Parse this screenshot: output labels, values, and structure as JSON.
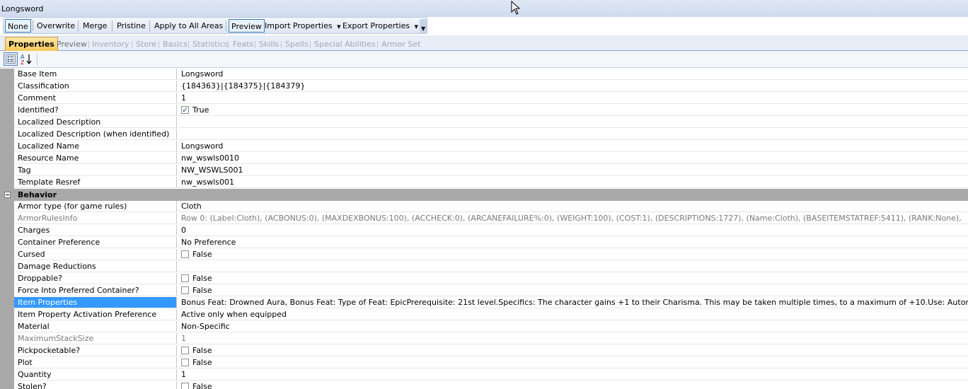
{
  "window": {
    "title": "Longsword"
  },
  "toolbar": {
    "none": "None",
    "overwrite": "Overwrite",
    "merge": "Merge",
    "pristine": "Pristine",
    "apply_all": "Apply to All Areas",
    "preview": "Preview",
    "import": "Import Properties",
    "export": "Export Properties"
  },
  "tabs": [
    "Properties",
    "Preview",
    "Inventory",
    "Store",
    "Basics",
    "Statistics",
    "Feats",
    "Skills",
    "Spells",
    "Special Abilities",
    "Armor Set"
  ],
  "properties": {
    "misc": [
      {
        "name": "Base Item",
        "value": "Longsword"
      },
      {
        "name": "Classification",
        "value": "{184363}|{184375}|{184379}"
      },
      {
        "name": "Comment",
        "value": "1"
      },
      {
        "name": "Identified?",
        "value": "True",
        "checkbox": true,
        "checked": true
      },
      {
        "name": "Localized Description",
        "value": ""
      },
      {
        "name": "Localized Description (when identified)",
        "value": ""
      },
      {
        "name": "Localized Name",
        "value": "Longsword"
      },
      {
        "name": "Resource Name",
        "value": "nw_wswls0010"
      },
      {
        "name": "Tag",
        "value": "NW_WSWLS001"
      },
      {
        "name": "Template Resref",
        "value": "nw_wswls001"
      }
    ],
    "behavior_label": "Behavior",
    "behavior": [
      {
        "name": "Armor type (for game rules)",
        "value": "Cloth"
      },
      {
        "name": "ArmorRulesInfo",
        "value": "Row 0:  (Label:Cloth), (ACBONUS:0), (MAXDEXBONUS:100), (ACCHECK:0), (ARCANEFAILURE%:0), (WEIGHT:100), (COST:1), (DESCRIPTIONS:1727), (Name:Cloth), (BASEITEMSTATREF:5411), (RANK:None),",
        "readonly": true
      },
      {
        "name": "Charges",
        "value": "0"
      },
      {
        "name": "Container Preference",
        "value": "No Preference"
      },
      {
        "name": "Cursed",
        "value": "False",
        "checkbox": true,
        "checked": false
      },
      {
        "name": "Damage Reductions",
        "value": ""
      },
      {
        "name": "Droppable?",
        "value": "False",
        "checkbox": true,
        "checked": false
      },
      {
        "name": "Force Into Preferred Container?",
        "value": "False",
        "checkbox": true,
        "checked": false
      },
      {
        "name": "Item Properties",
        "value": "Bonus Feat: Drowned Aura, Bonus Feat: Type of Feat: EpicPrerequisite: 21st level.Specifics: The character gains +1 to their Charisma. This may be taken multiple times, to a maximum of +10.Use: Automatic.",
        "selected": true
      },
      {
        "name": "Item Property Activation Preference",
        "value": "Active only when equipped"
      },
      {
        "name": "Material",
        "value": "Non-Specific"
      },
      {
        "name": "MaximumStackSize",
        "value": "1",
        "readonly": true
      },
      {
        "name": "Pickpocketable?",
        "value": "False",
        "checkbox": true,
        "checked": false
      },
      {
        "name": "Plot",
        "value": "False",
        "checkbox": true,
        "checked": false
      },
      {
        "name": "Quantity",
        "value": "1"
      },
      {
        "name": "Stolen?",
        "value": "False",
        "checkbox": true,
        "checked": false
      }
    ]
  },
  "icons": {
    "categorized": "categorized-view-icon",
    "alphabetical": "alphabetical-sort-icon",
    "cursor": "mouse-cursor-icon"
  }
}
